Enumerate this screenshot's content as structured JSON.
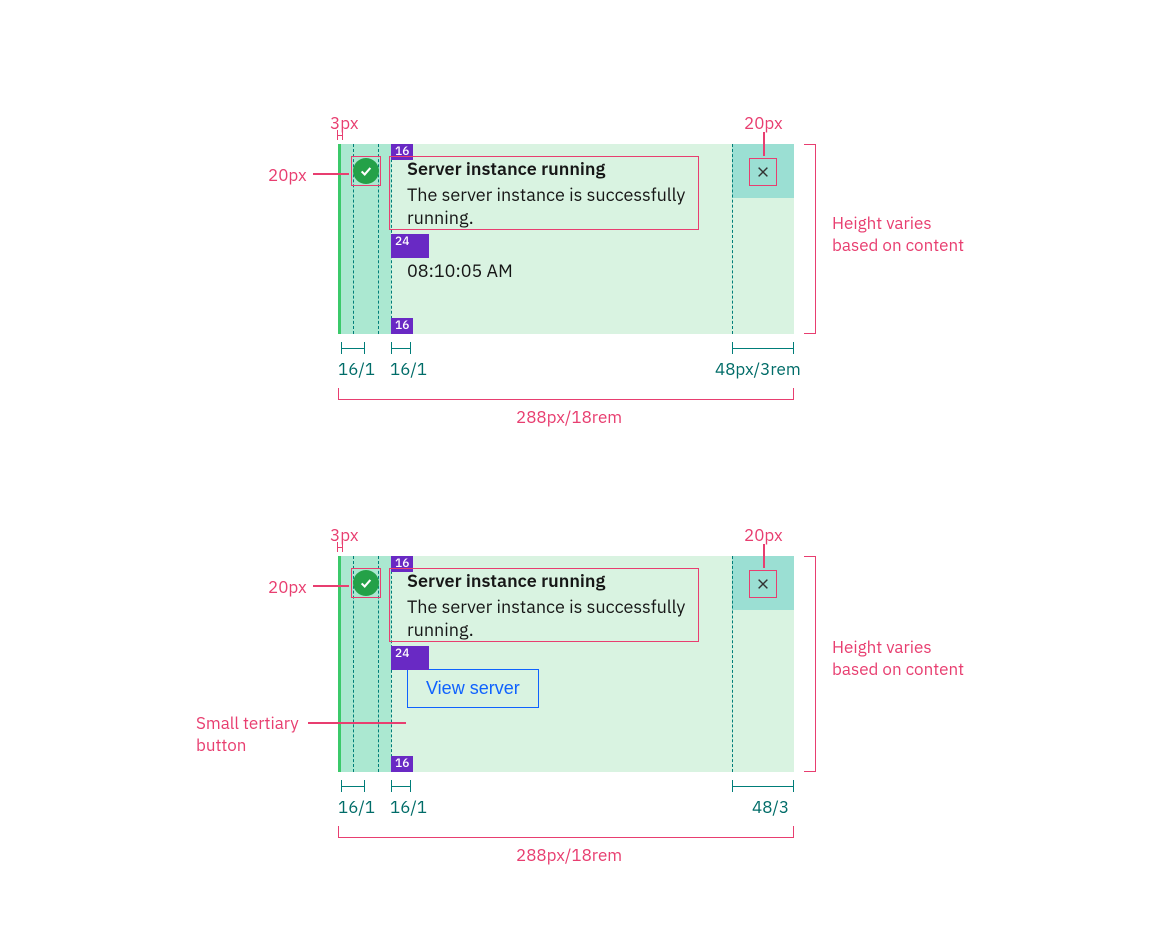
{
  "spec1": {
    "stripe_label": "3px",
    "icon_label": "20px",
    "close_label": "20px",
    "height_note_l1": "Height varies",
    "height_note_l2": "based on content",
    "seg_left": "16/1",
    "seg_left2": "16/1",
    "seg_right": "48px/3rem",
    "width_label": "288px/18rem",
    "toast": {
      "title": "Server instance running",
      "body": "The server instance is successfully running.",
      "timestamp": "08:10:05 AM",
      "spacer_top": "16",
      "spacer_mid": "24",
      "spacer_bot": "16"
    }
  },
  "spec2": {
    "stripe_label": "3px",
    "icon_label": "20px",
    "close_label": "20px",
    "height_note_l1": "Height varies",
    "height_note_l2": "based on content",
    "button_note_l1": "Small tertiary",
    "button_note_l2": "button",
    "seg_left": "16/1",
    "seg_left2": "16/1",
    "seg_right": "48/3",
    "width_label": "288px/18rem",
    "toast": {
      "title": "Server instance running",
      "body": "The server instance is successfully running.",
      "action_label": "View server",
      "spacer_top": "16",
      "spacer_mid": "24",
      "spacer_bot": "16"
    }
  }
}
